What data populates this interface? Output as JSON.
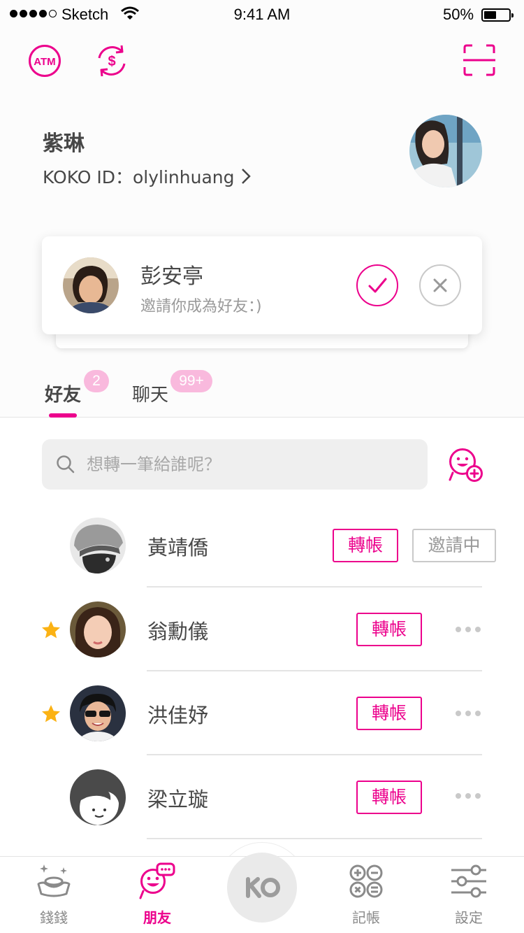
{
  "status_bar": {
    "carrier": "Sketch",
    "time": "9:41 AM",
    "battery_percent": "50%",
    "battery_level": 0.5
  },
  "header_icons": [
    "atm-icon",
    "currency-exchange-icon",
    "scan-icon"
  ],
  "profile": {
    "name": "紫琳",
    "id_label": "KOKO ID：olylinhuang"
  },
  "invite_card": {
    "name": "彭安亭",
    "message": "邀請你成為好友：)"
  },
  "tabs": [
    {
      "label": "好友",
      "badge": "2"
    },
    {
      "label": "聊天",
      "badge": "99+"
    }
  ],
  "search": {
    "placeholder": "想轉一筆給誰呢？"
  },
  "friends": [
    {
      "name": "黃靖僑",
      "starred": false,
      "transfer_label": "轉帳",
      "status_label": "邀請中"
    },
    {
      "name": "翁勳儀",
      "starred": true,
      "transfer_label": "轉帳"
    },
    {
      "name": "洪佳妤",
      "starred": true,
      "transfer_label": "轉帳"
    },
    {
      "name": "梁立璇",
      "starred": false,
      "transfer_label": "轉帳"
    }
  ],
  "tab_bar": {
    "items": [
      {
        "label": "錢錢",
        "icon": "money-icon",
        "active": false
      },
      {
        "label": "朋友",
        "icon": "friends-icon",
        "active": true
      },
      {
        "label": "記帳",
        "icon": "calculator-icon",
        "active": false
      },
      {
        "label": "設定",
        "icon": "settings-icon",
        "active": false
      }
    ],
    "center_label": "KO"
  },
  "colors": {
    "accent": "#ec008c",
    "badge": "#f9b9dd",
    "star": "#fbb214",
    "text": "#474747",
    "muted": "#999999"
  }
}
